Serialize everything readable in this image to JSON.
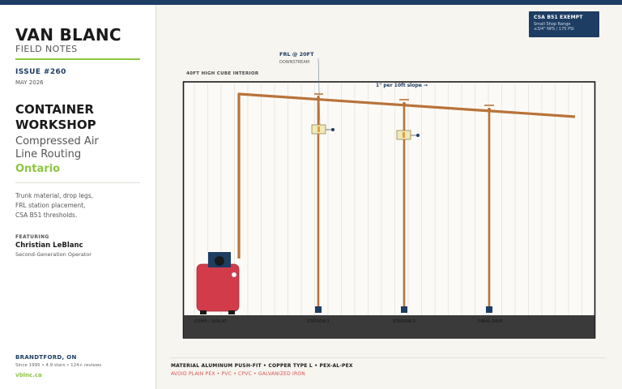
{
  "brand": {
    "name": "VAN BLANC",
    "sub": "FIELD NOTES"
  },
  "issue": {
    "number": "ISSUE #260",
    "date": "MAY 2026"
  },
  "article": {
    "title_lines": [
      "CONTAINER",
      "WORKSHOP"
    ],
    "subtitle_lines": [
      "Compressed Air",
      "Line Routing"
    ],
    "region": "Ontario",
    "description_lines": [
      "Trunk material, drop legs,",
      "FRL station placement,",
      "CSA B51 thresholds."
    ]
  },
  "featuring": {
    "label": "FEATURING",
    "name": "Christian LeBlanc",
    "role": "Second-Generation Operator"
  },
  "business": {
    "location": "BRANDTFORD, ON",
    "meta": "Since 1995  •  4.9 stars  •  124+ reviews",
    "url": "vblnc.ca"
  },
  "badge": {
    "title": "CSA B51 EXEMPT",
    "line1": "Small Shop Range",
    "line2": "≤3/4\" NPS / 175 PSI"
  },
  "diagram": {
    "container_label": "40FT HIGH CUBE INTERIOR",
    "frl_callout": {
      "title": "FRL @ 20FT",
      "sub": "DOWNSTREAM"
    },
    "slope_label": "1\" per 10ft slope →",
    "stations": [
      {
        "label": "COMP / ISOLAT"
      },
      {
        "label": "STATION 1"
      },
      {
        "label": "STATION 2"
      },
      {
        "label": "FINAL DRIP"
      }
    ],
    "colors": {
      "pipe": "#b8733a",
      "frame": "#1a1a1a",
      "floor": "#3a3a3a",
      "compressor": "#d23c4a",
      "valve": "#1d3d63",
      "frl_body": "#efe8b8"
    }
  },
  "footer": {
    "material": "MATERIAL  ALUMINUM PUSH-FIT  •  COPPER TYPE L  •  PEX-AL-PEX",
    "avoid": "AVOID  PLAIN PEX  •  PVC  •  CPVC  •  GALVANIZED IRON"
  }
}
